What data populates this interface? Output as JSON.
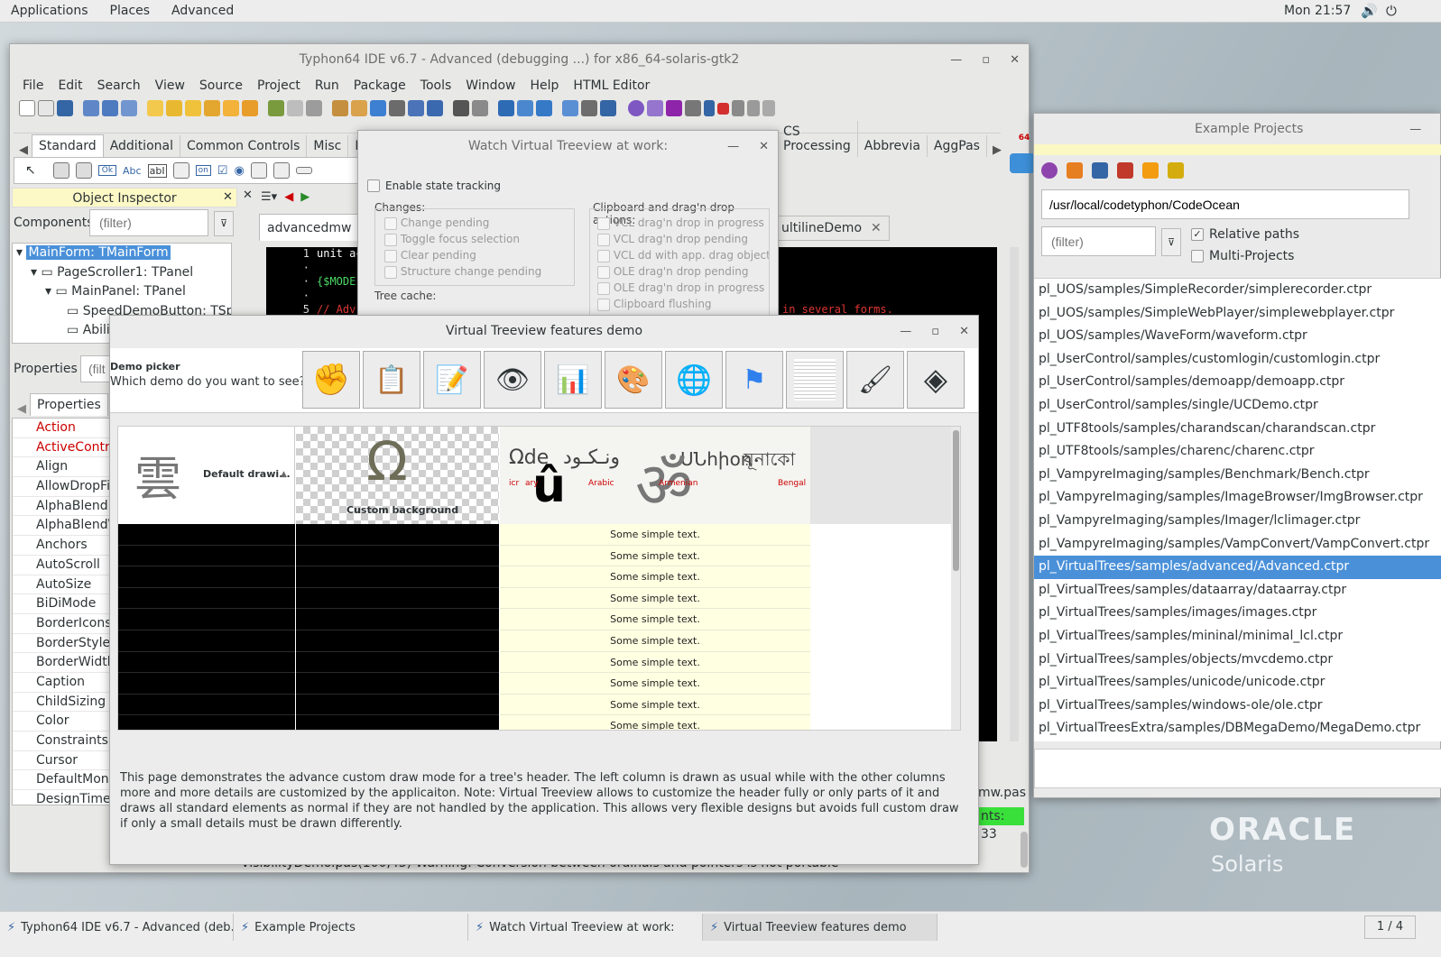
{
  "topbar": {
    "menus": [
      "Applications",
      "Places",
      "Advanced"
    ],
    "clock": "Mon 21:57"
  },
  "ide": {
    "title": "Typhon64 IDE v6.7 - Advanced (debugging ...) for x86_64-solaris-gtk2",
    "menus": [
      "File",
      "Edit",
      "Search",
      "View",
      "Source",
      "Project",
      "Run",
      "Package",
      "Tools",
      "Window",
      "Help",
      "HTML Editor"
    ],
    "palette_tabs": [
      "Standard",
      "Additional",
      "Common Controls",
      "Misc",
      "Dialo",
      "CS Processing",
      "Abbrevia",
      "AggPas"
    ],
    "palette_badge": "64",
    "palette_controls": [
      "Ok",
      "Abc",
      "abI",
      "on"
    ],
    "object_inspector": {
      "title": "Object Inspector",
      "components_label": "Components",
      "filter_placeholder": "(filter)",
      "tree": [
        "MainForm: TMainForm",
        "PageScroller1: TPanel",
        "MainPanel: TPanel",
        "SpeedDemoButton: TSp",
        "Abili"
      ],
      "properties_label": "Properties",
      "properties_filter": "(filt",
      "tabs": [
        "Properties",
        "E"
      ],
      "props": [
        "Action",
        "ActiveContro",
        "Align",
        "AllowDropFil",
        "AlphaBlend",
        "AlphaBlendV",
        "Anchors",
        "AutoScroll",
        "AutoSize",
        "BiDiMode",
        "BorderIcons",
        "BorderStyle",
        "BorderWidth",
        "Caption",
        "ChildSizing",
        "Color",
        "Constraints",
        "Cursor",
        "DefaultMonit",
        "DesignTimeP"
      ]
    },
    "editor": {
      "tabs": [
        "advancedmw",
        "ultilineDemo"
      ],
      "lines": [
        "1",
        "·",
        "·",
        "·",
        "5"
      ],
      "code": [
        "unit ac",
        "",
        "{$MODE",
        "",
        "// Adv"
      ],
      "code_right": "in several forms.",
      "status_file": "mw.pas",
      "status_counter": "nts: 33",
      "message": "VisibilityDemo.pas(100,45) Warning: Conversion between ordinals and pointers is not portable"
    }
  },
  "example_projects": {
    "title": "Example Projects",
    "path": "/usr/local/codetyphon/CodeOcean",
    "filter_placeholder": "(filter)",
    "relative_paths": "Relative paths",
    "multi_projects": "Multi-Projects",
    "items": [
      "pl_UOS/samples/SimpleRecorder/simplerecorder.ctpr",
      "pl_UOS/samples/SimpleWebPlayer/simplewebplayer.ctpr",
      "pl_UOS/samples/WaveForm/waveform.ctpr",
      "pl_UserControl/samples/customlogin/customlogin.ctpr",
      "pl_UserControl/samples/demoapp/demoapp.ctpr",
      "pl_UserControl/samples/single/UCDemo.ctpr",
      "pl_UTF8tools/samples/charandscan/charandscan.ctpr",
      "pl_UTF8tools/samples/charenc/charenc.ctpr",
      "pl_VampyreImaging/samples/Benchmark/Bench.ctpr",
      "pl_VampyreImaging/samples/ImageBrowser/ImgBrowser.ctpr",
      "pl_VampyreImaging/samples/Imager/lclimager.ctpr",
      "pl_VampyreImaging/samples/VampConvert/VampConvert.ctpr",
      "pl_VirtualTrees/samples/advanced/Advanced.ctpr",
      "pl_VirtualTrees/samples/dataarray/dataarray.ctpr",
      "pl_VirtualTrees/samples/images/images.ctpr",
      "pl_VirtualTrees/samples/mininal/minimal_lcl.ctpr",
      "pl_VirtualTrees/samples/objects/mvcdemo.ctpr",
      "pl_VirtualTrees/samples/unicode/unicode.ctpr",
      "pl_VirtualTrees/samples/windows-ole/ole.ctpr",
      "pl_VirtualTreesExtra/samples/DBMegaDemo/MegaDemo.ctpr"
    ],
    "selected_index": 12
  },
  "watch": {
    "title": "Watch Virtual Treeview at work:",
    "enable_state": "Enable state tracking",
    "changes_label": "Changes:",
    "changes": [
      "Change pending",
      "Toggle focus selection",
      "Clear pending",
      "Structure change pending"
    ],
    "clipboard_label": "Clipboard and drag'n drop actions:",
    "clipboard": [
      "VCL drag'n drop in progress",
      "VCL drag'n drop pending",
      "VCL dd with app. drag object",
      "OLE drag'n drop pending",
      "OLE drag'n drop in progress",
      "Clipboard flushing"
    ],
    "tree_cache": "Tree cache:"
  },
  "features": {
    "title": "Virtual Treeview features demo",
    "demo_picker": "Demo picker",
    "question": "Which demo do you want to see?",
    "header_default": "Default drawi...",
    "header_custom": "Custom background",
    "header_glyphs": [
      "Ωde",
      "ونـكـود",
      "ՍՆhիon",
      "য়ূনাকাে"
    ],
    "header_labels": [
      "icr",
      "ary",
      "Arabic",
      "Armenian",
      "Bengal"
    ],
    "row_text": "Some simple text.",
    "row_count": 10,
    "description": "This page demonstrates the advance custom draw mode for a tree's header. The left column is drawn as usual while with the other columns more and more details are customized by the applicaiton. Note: Virtual Treeview allows to customize the header fully or only parts of it and draws all standard elements as normal if they are not handled by the application. This allows very flexible designs but avoids full custom draw if only a small details must be drawn differently."
  },
  "brand": {
    "name": "ORACLE",
    "sub": "Solaris"
  },
  "taskbar": {
    "items": [
      "Typhon64 IDE v6.7 - Advanced (deb...",
      "Example Projects",
      "Watch Virtual Treeview at work:",
      "Virtual Treeview features demo"
    ],
    "workspace": "1 / 4"
  }
}
